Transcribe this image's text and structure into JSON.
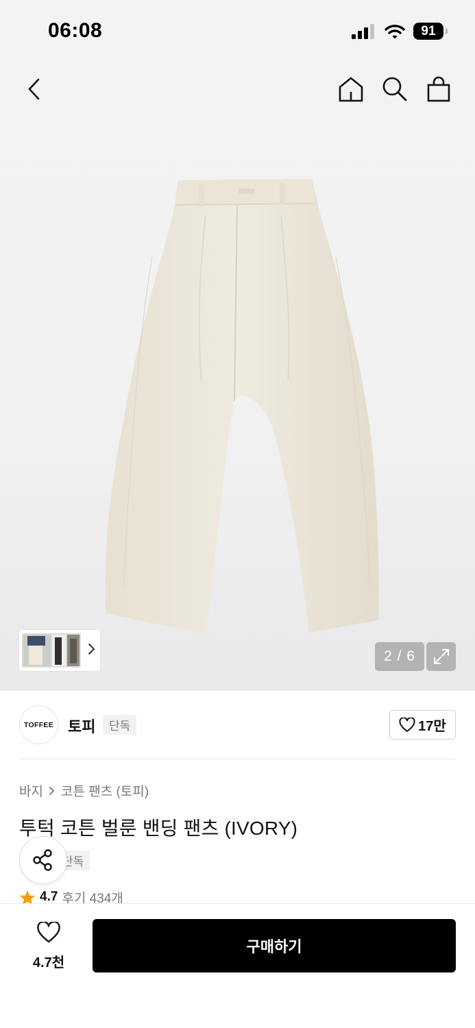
{
  "status": {
    "time": "06:08",
    "battery": "91"
  },
  "gallery": {
    "counter": "2 / 6"
  },
  "brand": {
    "logo_text": "TOFFEE",
    "name": "토피",
    "badge": "단독",
    "like_count": "17만"
  },
  "breadcrumb": {
    "category": "바지",
    "subcategory": "코튼 팬츠 (토피)"
  },
  "product": {
    "title": "투턱 코튼 벌룬 밴딩 팬츠 (IVORY)",
    "exclusive": "단독",
    "rating": "4.7",
    "reviews": "후기 434개"
  },
  "bottom": {
    "wish_count": "4.7천",
    "buy_label": "구매하기"
  },
  "colors": {
    "buy_button": "#000000",
    "star": "#f59e0b",
    "pants": "#ece6d9"
  },
  "icons": [
    "back-icon",
    "home-icon",
    "search-icon",
    "bag-icon",
    "chevron-right-icon",
    "expand-icon",
    "heart-icon",
    "share-icon",
    "star-icon"
  ]
}
